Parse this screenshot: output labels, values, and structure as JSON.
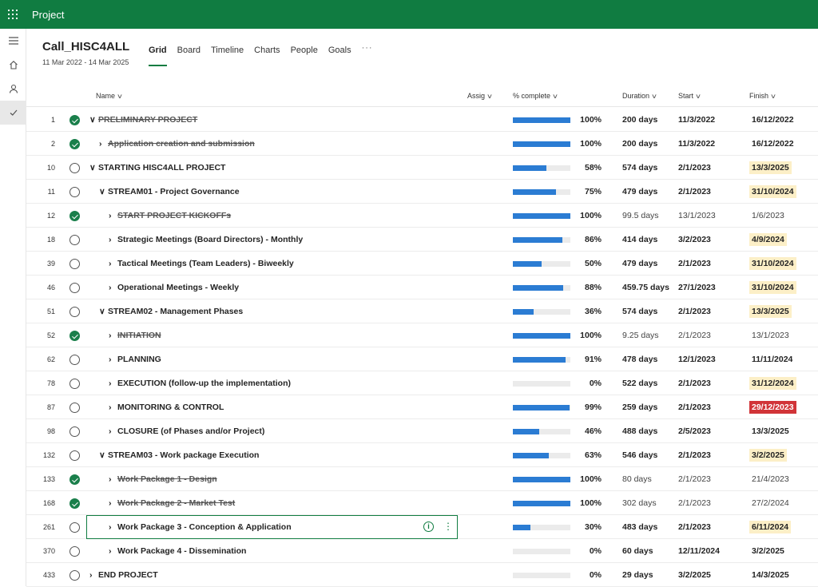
{
  "app": {
    "title": "Project"
  },
  "project": {
    "title": "Call_HISC4ALL",
    "dates": "11 Mar 2022 - 14 Mar 2025"
  },
  "tabs": [
    {
      "label": "Grid"
    },
    {
      "label": "Board"
    },
    {
      "label": "Timeline"
    },
    {
      "label": "Charts"
    },
    {
      "label": "People"
    },
    {
      "label": "Goals"
    },
    {
      "label": "···"
    }
  ],
  "columns": {
    "name": "Name",
    "assigned": "Assig",
    "percent": "% complete",
    "duration": "Duration",
    "start": "Start",
    "finish": "Finish"
  },
  "colors": {
    "brand": "#107c41",
    "progress": "#2b7cd3",
    "complete": "#1a7f4b",
    "warn_bg": "#fcefc7",
    "late_bg": "#d13438"
  },
  "tasks": [
    {
      "id": "1",
      "done": true,
      "indent": 0,
      "arrow": "∨",
      "name": "PRELIMINARY PROJECT",
      "pct": "100%",
      "progress": 1.0,
      "duration": "200 days",
      "start": "11/3/2022",
      "finish": "16/12/2022",
      "finish_style": "bold"
    },
    {
      "id": "2",
      "done": true,
      "indent": 1,
      "arrow": "›",
      "name": "Application creation and submission",
      "pct": "100%",
      "progress": 1.0,
      "duration": "200 days",
      "start": "11/3/2022",
      "finish": "16/12/2022",
      "finish_style": "bold"
    },
    {
      "id": "10",
      "done": false,
      "indent": 0,
      "arrow": "∨",
      "name": "STARTING HISC4ALL PROJECT",
      "pct": "58%",
      "progress": 0.58,
      "duration": "574 days",
      "start": "2/1/2023",
      "finish": "13/3/2025",
      "finish_style": "warn"
    },
    {
      "id": "11",
      "done": false,
      "indent": 1,
      "arrow": "∨",
      "name": "STREAM01 - Project Governance",
      "pct": "75%",
      "progress": 0.75,
      "duration": "479 days",
      "start": "2/1/2023",
      "finish": "31/10/2024",
      "finish_style": "warn"
    },
    {
      "id": "12",
      "done": true,
      "indent": 2,
      "arrow": "›",
      "name": "START PROJECT KICKOFFs",
      "pct": "100%",
      "progress": 1.0,
      "duration": "99.5 days",
      "start": "13/1/2023",
      "finish": "1/6/2023",
      "finish_style": "light"
    },
    {
      "id": "18",
      "done": false,
      "indent": 2,
      "arrow": "›",
      "name": "Strategic Meetings (Board Directors) - Monthly",
      "pct": "86%",
      "progress": 0.86,
      "duration": "414 days",
      "start": "3/2/2023",
      "finish": "4/9/2024",
      "finish_style": "warn"
    },
    {
      "id": "39",
      "done": false,
      "indent": 2,
      "arrow": "›",
      "name": "Tactical Meetings (Team Leaders) - Biweekly",
      "pct": "50%",
      "progress": 0.5,
      "duration": "479 days",
      "start": "2/1/2023",
      "finish": "31/10/2024",
      "finish_style": "warn"
    },
    {
      "id": "46",
      "done": false,
      "indent": 2,
      "arrow": "›",
      "name": "Operational Meetings - Weekly",
      "pct": "88%",
      "progress": 0.88,
      "duration": "459.75 days",
      "start": "27/1/2023",
      "finish": "31/10/2024",
      "finish_style": "warn"
    },
    {
      "id": "51",
      "done": false,
      "indent": 1,
      "arrow": "∨",
      "name": "STREAM02 - Management Phases",
      "pct": "36%",
      "progress": 0.36,
      "duration": "574 days",
      "start": "2/1/2023",
      "finish": "13/3/2025",
      "finish_style": "warn"
    },
    {
      "id": "52",
      "done": true,
      "indent": 2,
      "arrow": "›",
      "name": "INITIATION",
      "pct": "100%",
      "progress": 1.0,
      "duration": "9.25 days",
      "start": "2/1/2023",
      "finish": "13/1/2023",
      "finish_style": "light"
    },
    {
      "id": "62",
      "done": false,
      "indent": 2,
      "arrow": "›",
      "name": "PLANNING",
      "pct": "91%",
      "progress": 0.91,
      "duration": "478 days",
      "start": "12/1/2023",
      "finish": "11/11/2024",
      "finish_style": "bold"
    },
    {
      "id": "78",
      "done": false,
      "indent": 2,
      "arrow": "›",
      "name": "EXECUTION (follow-up the implementation)",
      "pct": "0%",
      "progress": 0.0,
      "duration": "522 days",
      "start": "2/1/2023",
      "finish": "31/12/2024",
      "finish_style": "warn"
    },
    {
      "id": "87",
      "done": false,
      "indent": 2,
      "arrow": "›",
      "name": "MONITORING & CONTROL",
      "pct": "99%",
      "progress": 0.99,
      "duration": "259 days",
      "start": "2/1/2023",
      "finish": "29/12/2023",
      "finish_style": "late"
    },
    {
      "id": "98",
      "done": false,
      "indent": 2,
      "arrow": "›",
      "name": "CLOSURE (of Phases and/or Project)",
      "pct": "46%",
      "progress": 0.46,
      "duration": "488 days",
      "start": "2/5/2023",
      "finish": "13/3/2025",
      "finish_style": "bold"
    },
    {
      "id": "132",
      "done": false,
      "indent": 1,
      "arrow": "∨",
      "name": "STREAM03 - Work package Execution",
      "pct": "63%",
      "progress": 0.63,
      "duration": "546 days",
      "start": "2/1/2023",
      "finish": "3/2/2025",
      "finish_style": "warn"
    },
    {
      "id": "133",
      "done": true,
      "indent": 2,
      "arrow": "›",
      "name": "Work Package 1 - Design",
      "pct": "100%",
      "progress": 1.0,
      "duration": "80 days",
      "start": "2/1/2023",
      "finish": "21/4/2023",
      "finish_style": "light"
    },
    {
      "id": "168",
      "done": true,
      "indent": 2,
      "arrow": "›",
      "name": "Work Package 2 - Market Test",
      "pct": "100%",
      "progress": 1.0,
      "duration": "302 days",
      "start": "2/1/2023",
      "finish": "27/2/2024",
      "finish_style": "light"
    },
    {
      "id": "261",
      "done": false,
      "indent": 2,
      "arrow": "›",
      "name": "Work Package 3 - Conception & Application",
      "pct": "30%",
      "progress": 0.3,
      "duration": "483 days",
      "start": "2/1/2023",
      "finish": "6/11/2024",
      "finish_style": "warn",
      "selected": true
    },
    {
      "id": "370",
      "done": false,
      "indent": 2,
      "arrow": "›",
      "name": "Work Package 4 - Dissemination",
      "pct": "0%",
      "progress": 0.0,
      "duration": "60 days",
      "start": "12/11/2024",
      "finish": "3/2/2025",
      "finish_style": "bold"
    },
    {
      "id": "433",
      "done": false,
      "indent": 0,
      "arrow": "›",
      "name": "END PROJECT",
      "pct": "0%",
      "progress": 0.0,
      "duration": "29 days",
      "start": "3/2/2025",
      "finish": "14/3/2025",
      "finish_style": "bold"
    }
  ]
}
